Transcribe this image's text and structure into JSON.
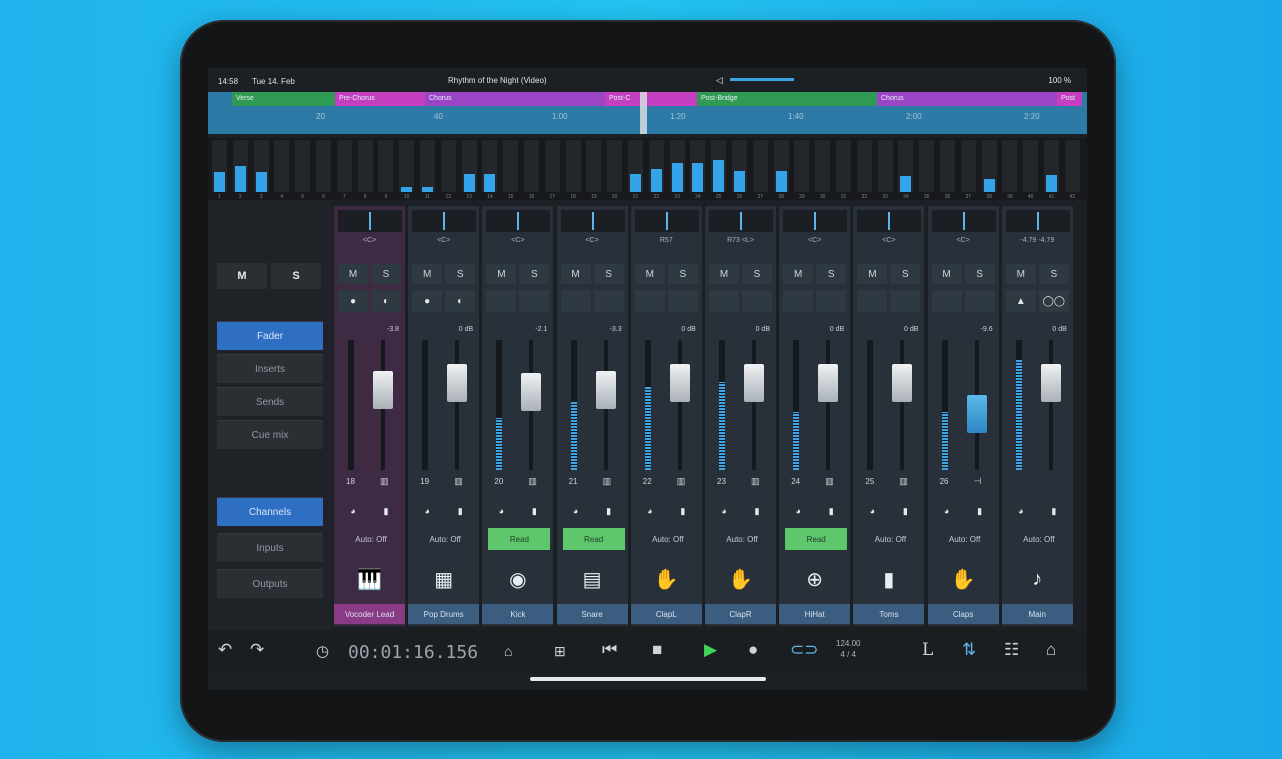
{
  "status": {
    "time": "14:58",
    "date": "Tue 14. Feb",
    "doc_title": "Rhythm of the Night (Video)",
    "battery": "100 %"
  },
  "arranger": {
    "sections": [
      {
        "label": "Verse",
        "color": "#2e9a53"
      },
      {
        "label": "Pre-Chorus",
        "color": "#c43fbf"
      },
      {
        "label": "Chorus",
        "color": "#9b45c6"
      },
      {
        "label": "Post-C",
        "color": "#c43fbf"
      },
      {
        "label": "",
        "color": "#c43fbf"
      },
      {
        "label": "Post-Bridge",
        "color": "#2e9a53"
      },
      {
        "label": "Chorus",
        "color": "#9b45c6"
      },
      {
        "label": "Post",
        "color": "#c43fbf"
      }
    ],
    "time_marks": [
      "20",
      "40",
      "1:00",
      "1:20",
      "1:40",
      "2:00",
      "2:20"
    ]
  },
  "mini_meters": [
    {
      "n": "1",
      "level": 0.38
    },
    {
      "n": "2",
      "level": 0.5
    },
    {
      "n": "3",
      "level": 0.38
    },
    {
      "n": "4",
      "level": 0
    },
    {
      "n": "5",
      "level": 0
    },
    {
      "n": "6",
      "level": 0
    },
    {
      "n": "7",
      "level": 0
    },
    {
      "n": "8",
      "level": 0
    },
    {
      "n": "9",
      "level": 0
    },
    {
      "n": "10",
      "level": 0.1
    },
    {
      "n": "11",
      "level": 0.1
    },
    {
      "n": "12",
      "level": 0
    },
    {
      "n": "13",
      "level": 0.35
    },
    {
      "n": "14",
      "level": 0.35
    },
    {
      "n": "15",
      "level": 0
    },
    {
      "n": "16",
      "level": 0
    },
    {
      "n": "17",
      "level": 0
    },
    {
      "n": "18",
      "level": 0
    },
    {
      "n": "19",
      "level": 0
    },
    {
      "n": "20",
      "level": 0
    },
    {
      "n": "21",
      "level": 0.35
    },
    {
      "n": "22",
      "level": 0.45
    },
    {
      "n": "23",
      "level": 0.55
    },
    {
      "n": "24",
      "level": 0.55
    },
    {
      "n": "25",
      "level": 0.62
    },
    {
      "n": "26",
      "level": 0.4
    },
    {
      "n": "27",
      "level": 0
    },
    {
      "n": "28",
      "level": 0.4
    },
    {
      "n": "29",
      "level": 0
    },
    {
      "n": "30",
      "level": 0
    },
    {
      "n": "31",
      "level": 0
    },
    {
      "n": "32",
      "level": 0
    },
    {
      "n": "33",
      "level": 0
    },
    {
      "n": "34",
      "level": 0.3
    },
    {
      "n": "35",
      "level": 0
    },
    {
      "n": "36",
      "level": 0
    },
    {
      "n": "37",
      "level": 0
    },
    {
      "n": "38",
      "level": 0.25
    },
    {
      "n": "39",
      "level": 0
    },
    {
      "n": "40",
      "level": 0
    },
    {
      "n": "41",
      "level": 0.32
    },
    {
      "n": "42",
      "level": 0
    }
  ],
  "left_panel": {
    "mute": "M",
    "solo": "S",
    "views": [
      {
        "label": "Fader",
        "active": true
      },
      {
        "label": "Inserts",
        "active": false
      },
      {
        "label": "Sends",
        "active": false
      },
      {
        "label": "Cue mix",
        "active": false
      }
    ],
    "lists": [
      {
        "label": "Channels",
        "active": true
      },
      {
        "label": "Inputs",
        "active": false
      },
      {
        "label": "Outputs",
        "active": false
      }
    ]
  },
  "channels": [
    {
      "name": "Vocoder Lead",
      "num": "18",
      "pan": "<C>",
      "gain": "-3.8",
      "meter": 0.0,
      "fader": 0.72,
      "auto": "Auto: Off",
      "read": false,
      "icon": "🎹",
      "selected": true,
      "ic1": "●",
      "ic2": "◐",
      "chico": "▥"
    },
    {
      "name": "Pop Drums",
      "num": "19",
      "pan": "<C>",
      "gain": "0 dB",
      "meter": 0.0,
      "fader": 0.78,
      "auto": "Auto: Off",
      "read": false,
      "icon": "▦",
      "selected": false,
      "ic1": "●",
      "ic2": "◐",
      "chico": "▥"
    },
    {
      "name": "Kick",
      "num": "20",
      "pan": "<C>",
      "gain": "-2.1",
      "meter": 0.4,
      "fader": 0.7,
      "auto": "Read",
      "read": true,
      "icon": "◉",
      "selected": false,
      "ic1": "",
      "ic2": "",
      "chico": "▥"
    },
    {
      "name": "Snare",
      "num": "21",
      "pan": "<C>",
      "gain": "-3.3",
      "meter": 0.52,
      "fader": 0.72,
      "auto": "Read",
      "read": true,
      "icon": "▤",
      "selected": false,
      "ic1": "",
      "ic2": "",
      "chico": "▥"
    },
    {
      "name": "ClapL",
      "num": "22",
      "pan": "R57",
      "gain": "0 dB",
      "meter": 0.65,
      "fader": 0.78,
      "auto": "Auto: Off",
      "read": false,
      "icon": "✋",
      "selected": false,
      "ic1": "",
      "ic2": "",
      "chico": "▥"
    },
    {
      "name": "ClapR",
      "num": "23",
      "pan": "R73 <L>",
      "gain": "0 dB",
      "meter": 0.68,
      "fader": 0.78,
      "auto": "Auto: Off",
      "read": false,
      "icon": "✋",
      "selected": false,
      "ic1": "",
      "ic2": "",
      "chico": "▥"
    },
    {
      "name": "HiHat",
      "num": "24",
      "pan": "<C>",
      "gain": "0 dB",
      "meter": 0.45,
      "fader": 0.78,
      "auto": "Read",
      "read": true,
      "icon": "⊕",
      "selected": false,
      "ic1": "",
      "ic2": "",
      "chico": "▥"
    },
    {
      "name": "Toms",
      "num": "25",
      "pan": "<C>",
      "gain": "0 dB",
      "meter": 0.0,
      "fader": 0.78,
      "auto": "Auto: Off",
      "read": false,
      "icon": "▮",
      "selected": false,
      "ic1": "",
      "ic2": "",
      "chico": "▥"
    },
    {
      "name": "Claps",
      "num": "26",
      "pan": "<C>",
      "gain": "-9.6",
      "meter": 0.45,
      "fader": 0.5,
      "auto": "Auto: Off",
      "read": false,
      "icon": "✋",
      "selected": false,
      "ic1": "",
      "ic2": "",
      "chico": "⊣"
    },
    {
      "name": "Main",
      "num": "",
      "pan": "-4.79  -4.79",
      "gain": "0 dB",
      "meter": 0.85,
      "fader": 0.78,
      "auto": "Auto: Off",
      "read": false,
      "icon": "♪",
      "selected": false,
      "ic1": "▲",
      "ic2": "◯◯",
      "chico": ""
    }
  ],
  "transport": {
    "time": "00:01:16.156",
    "tempo": "124.00",
    "signature": "4 / 4",
    "L": "L"
  }
}
